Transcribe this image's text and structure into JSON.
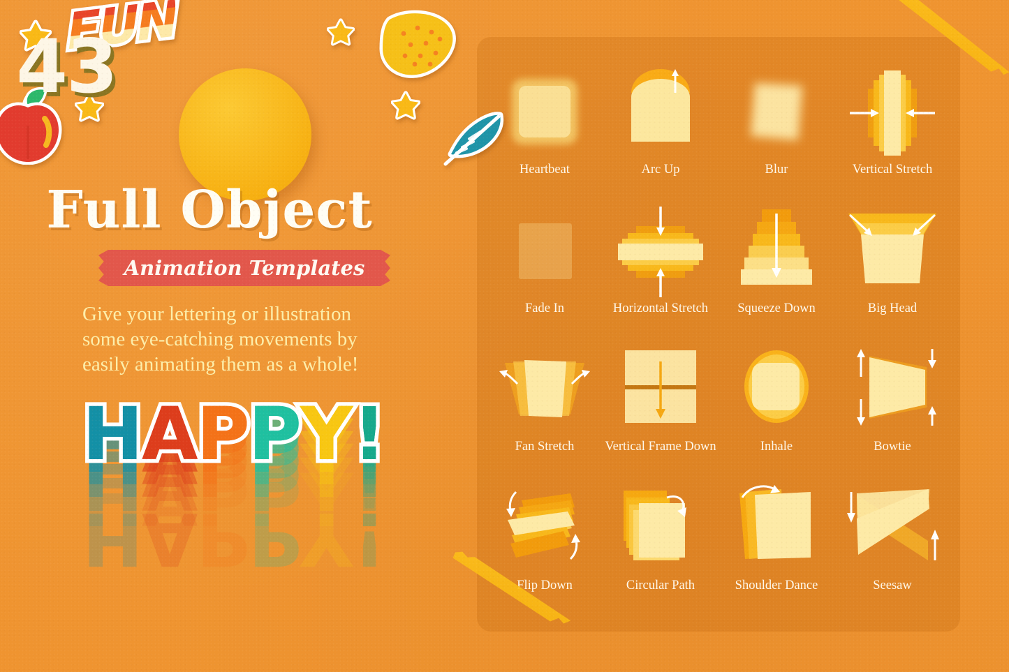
{
  "theme": {
    "background": "#ef9430",
    "panel_tint": "rgba(186,98,10,.24)",
    "badge_yellow": "#f7b113",
    "ribbon_red": "#e2574b",
    "caption_cream": "#fff8ea",
    "body_yellow": "#fdeeaa",
    "tape_gold": "#fbbe19"
  },
  "hero": {
    "count": "43",
    "title": "Full Object",
    "ribbon_label": "Animation Templates",
    "description_lines": [
      "Give your lettering or illustration",
      "some eye-catching movements by",
      "easily animating them as a whole!"
    ],
    "fun_sticker": "FUN",
    "happy_word": [
      {
        "char": "H",
        "color": "#1390a6"
      },
      {
        "char": "A",
        "color": "#dd3d1c"
      },
      {
        "char": "P",
        "color": "#f47218"
      },
      {
        "char": "P",
        "color": "#1fc0a0"
      },
      {
        "char": "Y",
        "color": "#f8c712"
      },
      {
        "char": "!",
        "color": "#16a98c"
      }
    ]
  },
  "stickers": [
    {
      "name": "star",
      "color": "#f9b916"
    },
    {
      "name": "apple",
      "color": "#e23b2e"
    },
    {
      "name": "lemon",
      "color": "#f6c018"
    },
    {
      "name": "feather",
      "color": "#1f94a8"
    }
  ],
  "panel": {
    "templates": [
      {
        "label": "Heartbeat",
        "icon": "heartbeat-glow-square"
      },
      {
        "label": "Arc Up",
        "icon": "arc-up-dome-arrow"
      },
      {
        "label": "Blur",
        "icon": "blur-skewed-square"
      },
      {
        "label": "Vertical Stretch",
        "icon": "vertical-stretch-inward-arrows"
      },
      {
        "label": "Fade In",
        "icon": "fade-in-faint-square"
      },
      {
        "label": "Horizontal Stretch",
        "icon": "horizontal-stretch-vertical-arrows"
      },
      {
        "label": "Squeeze Down",
        "icon": "squeeze-down-stack-arrow"
      },
      {
        "label": "Big Head",
        "icon": "big-head-trapezoid-arrows"
      },
      {
        "label": "Fan Stretch",
        "icon": "fan-stretch-curved-arrows"
      },
      {
        "label": "Vertical Frame Down",
        "icon": "vertical-frame-down-split-arrow"
      },
      {
        "label": "Inhale",
        "icon": "inhale-rounded-blob"
      },
      {
        "label": "Bowtie",
        "icon": "bowtie-updown-arrows"
      },
      {
        "label": "Flip Down",
        "icon": "flip-down-card-stack"
      },
      {
        "label": "Circular Path",
        "icon": "circular-path-offset-stack"
      },
      {
        "label": "Shoulder Dance",
        "icon": "shoulder-dance-tilt-arrow"
      },
      {
        "label": "Seesaw",
        "icon": "seesaw-crossed-bands"
      }
    ]
  }
}
